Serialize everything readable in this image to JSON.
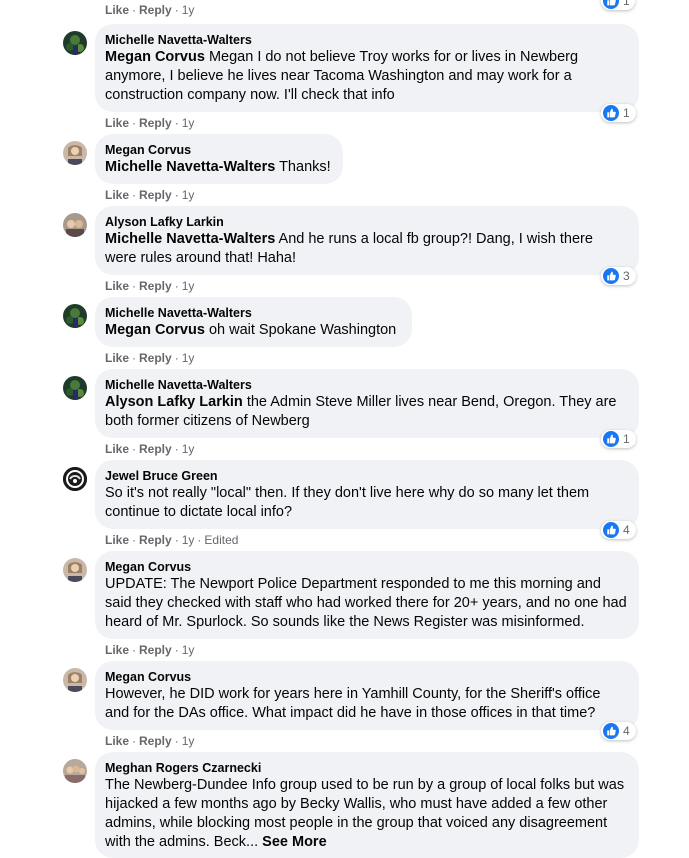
{
  "top": {
    "like": "Like",
    "reply": "Reply",
    "time": "1y",
    "reaction_count": "1"
  },
  "comments": [
    {
      "author": "Michelle Navetta-Walters",
      "mention": "Megan Corvus",
      "text": " Megan I do not believe Troy works for or lives in Newberg anymore, I believe he lives near Tacoma Washington and may work for a construction company now. I'll check that info",
      "like": "Like",
      "reply": "Reply",
      "time": "1y",
      "reaction_count": "1"
    },
    {
      "author": "Megan Corvus",
      "mention": "Michelle Navetta-Walters",
      "text": " Thanks!",
      "like": "Like",
      "reply": "Reply",
      "time": "1y"
    },
    {
      "author": "Alyson Lafky Larkin",
      "mention": "Michelle Navetta-Walters",
      "text": " And he runs a local fb group?! Dang, I wish there were rules around that! Haha!",
      "like": "Like",
      "reply": "Reply",
      "time": "1y",
      "reaction_count": "3"
    },
    {
      "author": "Michelle Navetta-Walters",
      "mention": "Megan Corvus",
      "text": " oh wait Spokane Washington",
      "like": "Like",
      "reply": "Reply",
      "time": "1y"
    },
    {
      "author": "Michelle Navetta-Walters",
      "mention": "Alyson Lafky Larkin",
      "text": " the Admin Steve Miller lives near Bend, Oregon. They are both former citizens of Newberg",
      "like": "Like",
      "reply": "Reply",
      "time": "1y",
      "reaction_count": "1"
    },
    {
      "author": "Jewel Bruce Green",
      "text": "So it's not really \"local\" then. If they don't live here why do so many let them continue to dictate local info?",
      "like": "Like",
      "reply": "Reply",
      "time": "1y",
      "edited": "Edited",
      "reaction_count": "4"
    },
    {
      "author": "Megan Corvus",
      "text": "UPDATE: The Newport Police Department responded to me this morning and said they checked with staff who had worked there for 20+ years, and no one had heard of Mr. Spurlock. So sounds like the News Register was misinformed.",
      "like": "Like",
      "reply": "Reply",
      "time": "1y"
    },
    {
      "author": "Megan Corvus",
      "text": "However, he DID work for years here in Yamhill County, for the Sheriff's office and for the DAs office. What impact did he have in those offices in that time?",
      "like": "Like",
      "reply": "Reply",
      "time": "1y",
      "reaction_count": "4"
    },
    {
      "author": "Meghan Rogers Czarnecki",
      "text": "The Newberg-Dundee Info group used to be run by a group of local folks but was hijacked a few months ago by Becky Wallis, who must have added a few other admins, while blocking most people in the group that voiced any disagreement with the admins. Beck...",
      "see_more": "See More"
    }
  ],
  "colors": {
    "bubble": "#f0f2f5",
    "secondary_text": "#65676b",
    "like_blue": "#1877f2"
  }
}
